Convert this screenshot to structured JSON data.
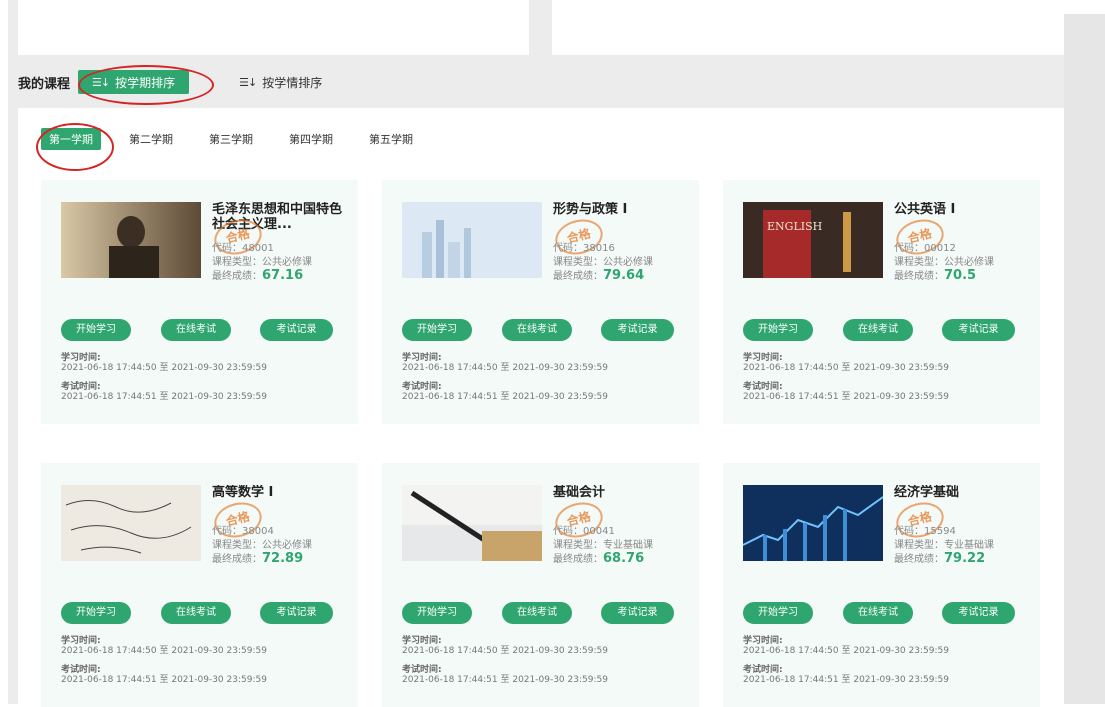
{
  "header": {
    "my_courses": "我的课程",
    "sort_by_term": "按学期排序",
    "sort_by_status": "按学情排序"
  },
  "semesters": [
    "第一学期",
    "第二学期",
    "第三学期",
    "第四学期",
    "第五学期"
  ],
  "active_semester_index": 0,
  "buttons": {
    "start": "开始学习",
    "exam": "在线考试",
    "record": "考试记录"
  },
  "labels": {
    "code": "代码：",
    "type": "课程类型：",
    "score": "最终成绩：",
    "study_time": "学习时间:",
    "exam_time": "考试时间:",
    "to": "至",
    "pass_stamp": "合格"
  },
  "courses": [
    {
      "title": "毛泽东思想和中国特色社会主义理...",
      "code": "48001",
      "type": "公共必修课",
      "score": "67.16",
      "study_from": "2021-06-18 17:44:50",
      "study_to": "2021-09-30 23:59:59",
      "exam_from": "2021-06-18 17:44:51",
      "exam_to": "2021-09-30 23:59:59",
      "thumb": "portrait-photo"
    },
    {
      "title": "形势与政策 I",
      "code": "38016",
      "type": "公共必修课",
      "score": "79.64",
      "study_from": "2021-06-18 17:44:50",
      "study_to": "2021-09-30 23:59:59",
      "exam_from": "2021-06-18 17:44:51",
      "exam_to": "2021-09-30 23:59:59",
      "thumb": "city-skyline"
    },
    {
      "title": "公共英语 I",
      "code": "00012",
      "type": "公共必修课",
      "score": "70.5",
      "study_from": "2021-06-18 17:44:50",
      "study_to": "2021-09-30 23:59:59",
      "exam_from": "2021-06-18 17:44:51",
      "exam_to": "2021-09-30 23:59:59",
      "thumb": "english-book",
      "thumb_text": "ENGLISH"
    },
    {
      "title": "高等数学 I",
      "code": "38004",
      "type": "公共必修课",
      "score": "72.89",
      "study_from": "2021-06-18 17:44:50",
      "study_to": "2021-09-30 23:59:59",
      "exam_from": "2021-06-18 17:44:51",
      "exam_to": "2021-09-30 23:59:59",
      "thumb": "math-formulas"
    },
    {
      "title": "基础会计",
      "code": "00041",
      "type": "专业基础课",
      "score": "68.76",
      "study_from": "2021-06-18 17:44:50",
      "study_to": "2021-09-30 23:59:59",
      "exam_from": "2021-06-18 17:44:51",
      "exam_to": "2021-09-30 23:59:59",
      "thumb": "pen-calculator"
    },
    {
      "title": "经济学基础",
      "code": "15594",
      "type": "专业基础课",
      "score": "79.22",
      "study_from": "2021-06-18 17:44:50",
      "study_to": "2021-09-30 23:59:59",
      "exam_from": "2021-06-18 17:44:51",
      "exam_to": "2021-09-30 23:59:59",
      "thumb": "stock-chart"
    }
  ],
  "colors": {
    "accent": "#2fa56f",
    "highlight": "#d62424",
    "stamp": "#e67828"
  }
}
